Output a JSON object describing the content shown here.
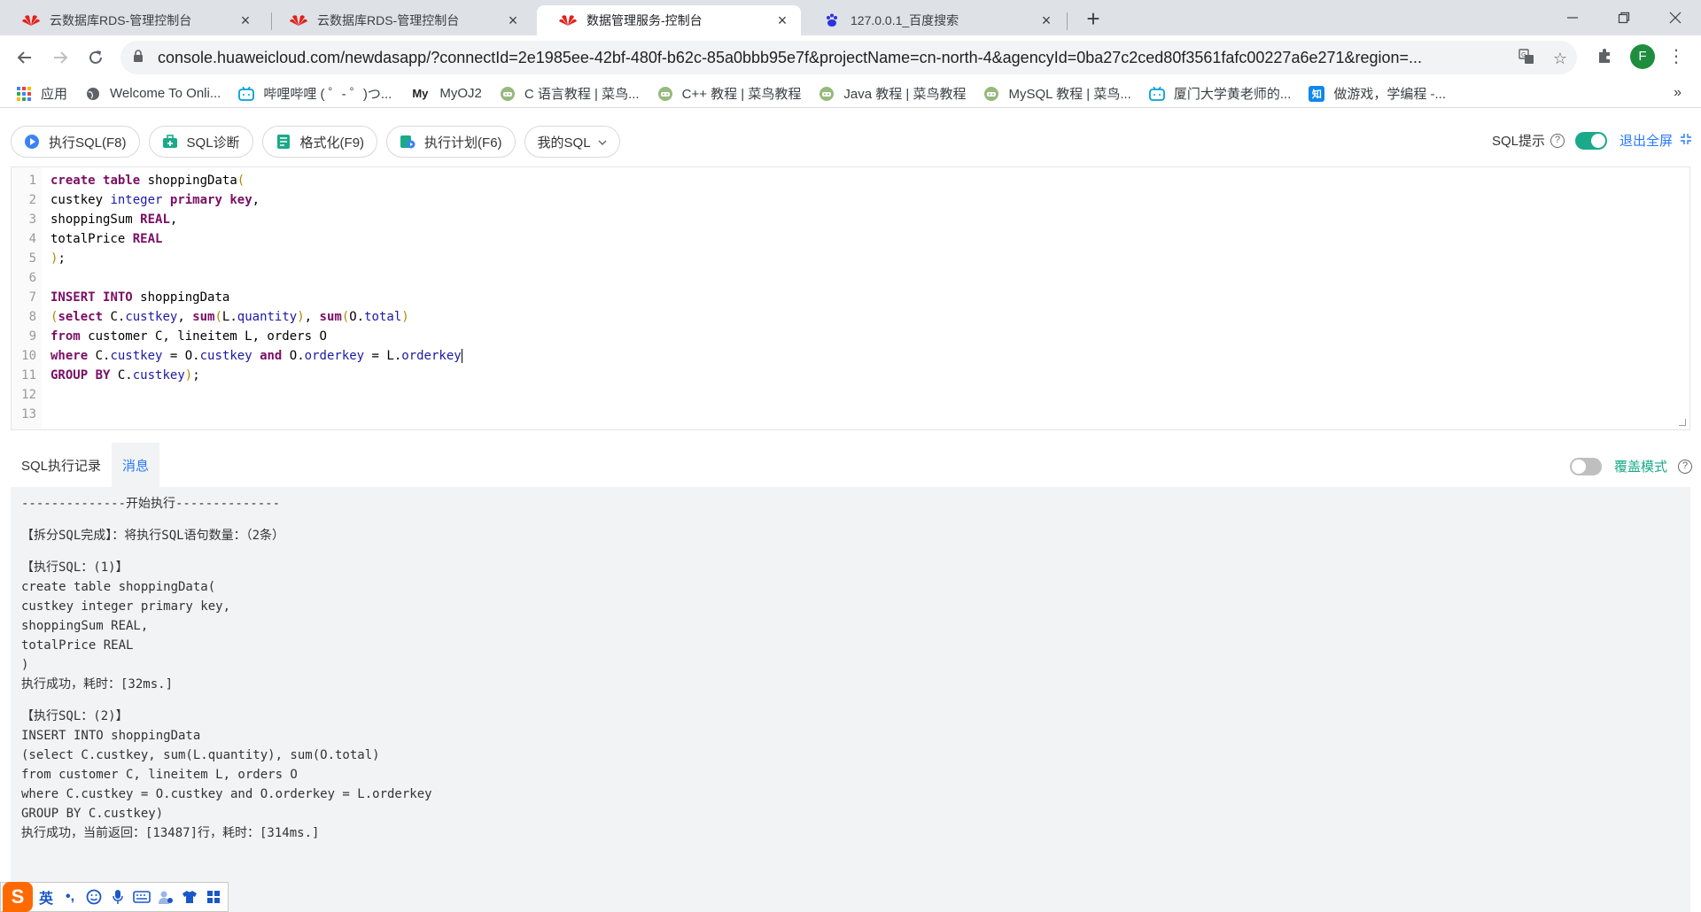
{
  "browser": {
    "tabs": [
      {
        "title": "云数据库RDS-管理控制台",
        "active": false,
        "favicon": "huawei-logo-icon"
      },
      {
        "title": "云数据库RDS-管理控制台",
        "active": false,
        "favicon": "huawei-logo-icon"
      },
      {
        "title": "数据管理服务-控制台",
        "active": true,
        "favicon": "huawei-logo-icon"
      },
      {
        "title": "127.0.0.1_百度搜索",
        "active": false,
        "favicon": "baidu-paw-icon"
      }
    ],
    "url": "console.huaweicloud.com/newdasapp/?connectId=2e1985ee-42bf-480f-b62c-85a0bbb95e7f&projectName=cn-north-4&agencyId=0ba27c2ced80f3561fafc00227a6e271&region=...",
    "profile_initial": "F",
    "bookmarks": [
      {
        "label": "应用",
        "icon": "apps-grid-icon"
      },
      {
        "label": "Welcome To Onli...",
        "icon": "globe-icon"
      },
      {
        "label": "哔哩哔哩 ( ゜- ゜)つ...",
        "icon": "bilibili-icon"
      },
      {
        "label": "MyOJ2",
        "icon": "myoj-icon"
      },
      {
        "label": "C 语言教程 | 菜鸟...",
        "icon": "runoob-icon"
      },
      {
        "label": "C++ 教程 | 菜鸟教程",
        "icon": "runoob-icon"
      },
      {
        "label": "Java 教程 | 菜鸟教程",
        "icon": "runoob-icon"
      },
      {
        "label": "MySQL 教程 | 菜鸟...",
        "icon": "runoob-icon"
      },
      {
        "label": "厦门大学黄老师的...",
        "icon": "bilibili-icon"
      },
      {
        "label": "做游戏，学编程 -...",
        "icon": "zhihu-icon"
      }
    ],
    "bookmarks_more": "»"
  },
  "toolbar": {
    "run_sql": "执行SQL(F8)",
    "sql_diagnose": "SQL诊断",
    "format": "格式化(F9)",
    "exec_plan": "执行计划(F6)",
    "my_sql": "我的SQL",
    "sql_hint_label": "SQL提示",
    "sql_hint_on": true,
    "exit_fullscreen": "退出全屏",
    "accent_color": "#1aaa8a",
    "link_color": "#2878ff"
  },
  "editor": {
    "line_numbers": [
      "1",
      "2",
      "3",
      "4",
      "5",
      "6",
      "7",
      "8",
      "9",
      "10",
      "11",
      "12",
      "13"
    ]
  },
  "results": {
    "tabs": [
      "SQL执行记录",
      "消息"
    ],
    "active_tab": "消息",
    "overlay_mode_label": "覆盖模式",
    "overlay_mode_on": false,
    "lines": [
      "--------------开始执行--------------",
      "",
      "【拆分SQL完成】：将执行SQL语句数量：（2条）",
      "",
      "【执行SQL：(1)】",
      "create table shoppingData(",
      "custkey integer primary key,",
      "shoppingSum REAL,",
      "totalPrice REAL",
      ")",
      "执行成功，耗时：[32ms.]",
      "",
      "【执行SQL：(2)】",
      "INSERT INTO shoppingData",
      "(select C.custkey, sum(L.quantity), sum(O.total)",
      "from customer C, lineitem L, orders O",
      "where C.custkey = O.custkey and O.orderkey = L.orderkey",
      "GROUP BY C.custkey)",
      "执行成功，当前返回：[13487]行，耗时：[314ms.]"
    ]
  },
  "ime": {
    "logo": "S",
    "mode": "英",
    "punct": "•,"
  }
}
